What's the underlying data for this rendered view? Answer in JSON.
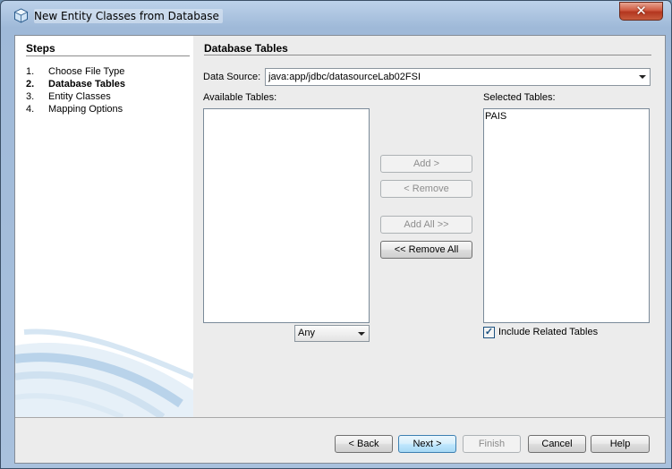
{
  "window": {
    "title": "New Entity Classes from Database",
    "close_glyph": "✕"
  },
  "steps": {
    "title": "Steps",
    "items": [
      {
        "num": "1.",
        "label": "Choose File Type"
      },
      {
        "num": "2.",
        "label": "Database Tables"
      },
      {
        "num": "3.",
        "label": "Entity Classes"
      },
      {
        "num": "4.",
        "label": "Mapping Options"
      }
    ]
  },
  "panel": {
    "title": "Database Tables",
    "data_source_label": "Data Source:",
    "data_source_value": "java:app/jdbc/datasourceLab02FSI",
    "available_label": "Available Tables:",
    "selected_label": "Selected Tables:",
    "selected_items": [
      "PAIS"
    ],
    "filter_value": "Any",
    "add_label": "Add >",
    "remove_label": "< Remove",
    "add_all_label": "Add All >>",
    "remove_all_label": "<< Remove All",
    "include_related_label": "Include Related Tables",
    "include_related_checked": true
  },
  "footer": {
    "back_label": "< Back",
    "next_label": "Next >",
    "finish_label": "Finish",
    "cancel_label": "Cancel",
    "help_label": "Help"
  }
}
